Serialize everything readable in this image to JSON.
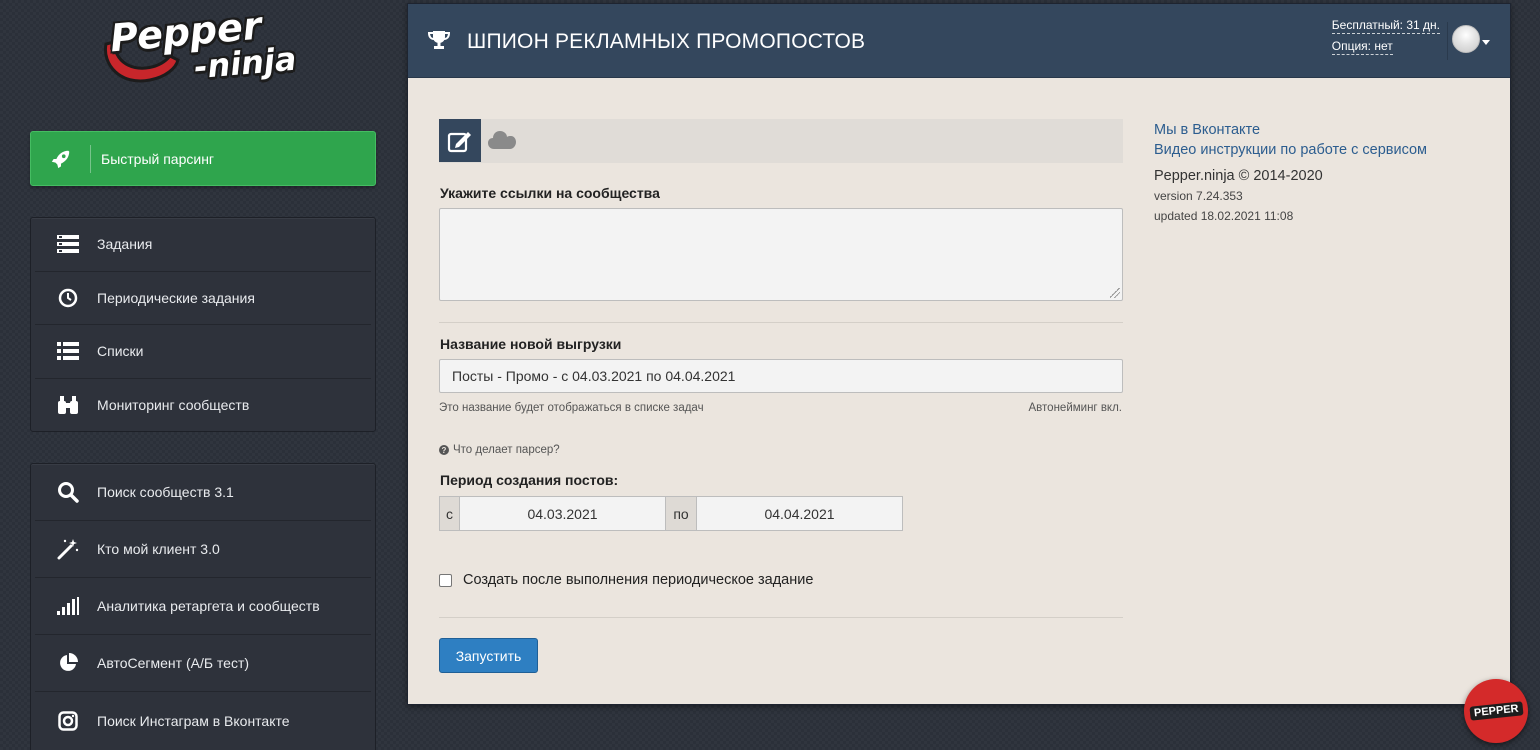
{
  "brand": {
    "logo_line1": "Pepper",
    "logo_line2": "-ninja",
    "accent_green": "#2fa54d",
    "header_navy": "#34475d",
    "button_blue": "#2e7fc2"
  },
  "sidebar": {
    "quick": {
      "label": "Быстрый парсинг",
      "icon": "rocket-icon"
    },
    "group1": [
      {
        "label": "Задания",
        "icon": "tasks-icon"
      },
      {
        "label": "Периодические задания",
        "icon": "clock-icon"
      },
      {
        "label": "Списки",
        "icon": "list-icon"
      },
      {
        "label": "Мониторинг сообществ",
        "icon": "binoculars-icon"
      }
    ],
    "group2": [
      {
        "label": "Поиск сообществ 3.1",
        "icon": "search-icon"
      },
      {
        "label": "Кто мой клиент 3.0",
        "icon": "magic-wand-icon"
      },
      {
        "label": "Аналитика ретаргета и сообществ",
        "icon": "signal-bars-icon"
      },
      {
        "label": "АвтоСегмент (А/Б тест)",
        "icon": "pie-chart-icon"
      },
      {
        "label": "Поиск Инстаграм в Вконтакте",
        "icon": "instagram-icon"
      }
    ]
  },
  "header": {
    "title": "ШПИОН РЕКЛАМНЫХ ПРОМОПОСТОВ",
    "icon": "trophy-icon",
    "free_days": "Бесплатный: 31 дн.",
    "option": "Опция: нет"
  },
  "form": {
    "communities_label": "Укажите ссылки на сообщества",
    "communities_value": "",
    "export_name_label": "Название новой выгрузки",
    "export_name_value": "Посты - Промо - с 04.03.2021 по 04.04.2021",
    "export_name_help": "Это название будет отображаться в списке задач",
    "autonaming": "Автонейминг вкл.",
    "what_parser": "Что делает парсер?",
    "period_label": "Период создания постов:",
    "from_label": "с",
    "from_value": "04.03.2021",
    "to_label": "по",
    "to_value": "04.04.2021",
    "periodic_label": "Создать после выполнения периодическое задание",
    "periodic_checked": false,
    "run_button": "Запустить"
  },
  "info": {
    "vk_link": "Мы в Вконтакте",
    "video_link": "Видео инструкции по работе с сервисом",
    "copyright": "Pepper.ninja © 2014-2020",
    "version": "version 7.24.353",
    "updated": "updated 18.02.2021 11:08"
  },
  "badge": {
    "label": "PEPPER"
  }
}
